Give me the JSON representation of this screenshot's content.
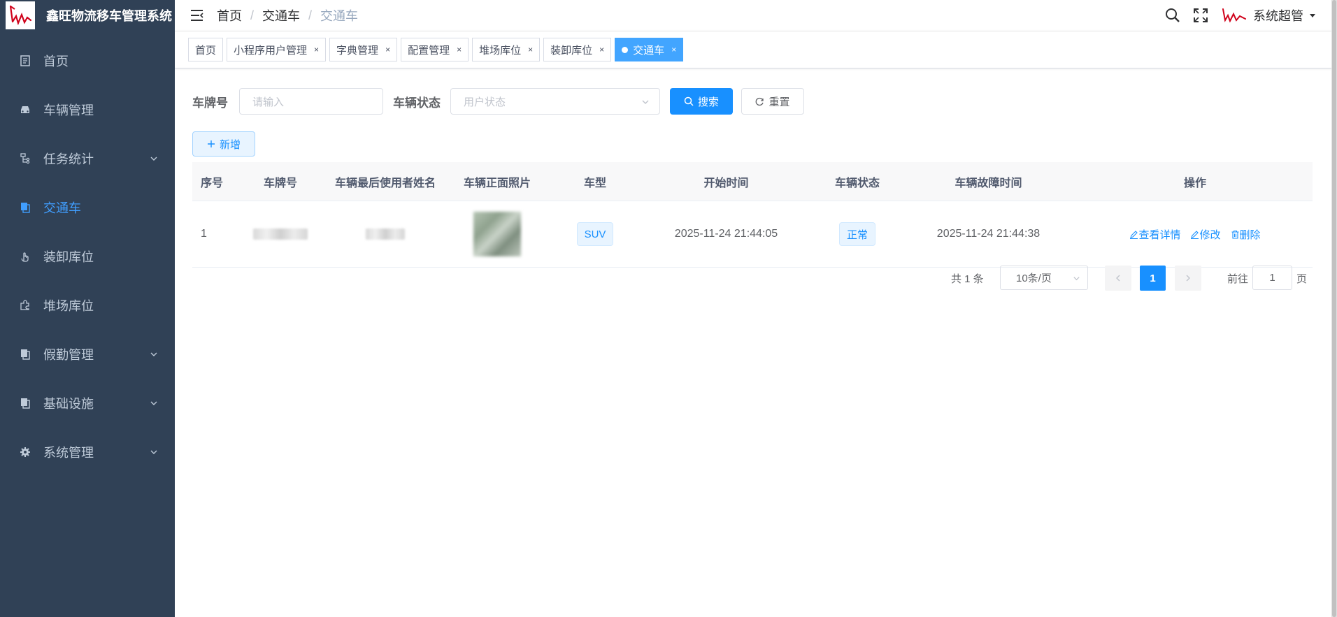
{
  "app": {
    "title": "鑫旺物流移车管理系统"
  },
  "sidebar": {
    "items": [
      {
        "label": "首页",
        "icon": "dashboard-icon",
        "active": false,
        "expandable": false
      },
      {
        "label": "车辆管理",
        "icon": "car-icon",
        "active": false,
        "expandable": false
      },
      {
        "label": "任务统计",
        "icon": "tree-icon",
        "active": false,
        "expandable": true
      },
      {
        "label": "交通车",
        "icon": "documents-icon",
        "active": true,
        "expandable": false
      },
      {
        "label": "装卸库位",
        "icon": "hand-icon",
        "active": false,
        "expandable": false
      },
      {
        "label": "堆场库位",
        "icon": "puzzle-icon",
        "active": false,
        "expandable": false
      },
      {
        "label": "假勤管理",
        "icon": "documents-icon",
        "active": false,
        "expandable": true
      },
      {
        "label": "基础设施",
        "icon": "documents-icon",
        "active": false,
        "expandable": true
      },
      {
        "label": "系统管理",
        "icon": "gear-icon",
        "active": false,
        "expandable": true
      }
    ]
  },
  "breadcrumb": {
    "items": [
      "首页",
      "交通车",
      "交通车"
    ]
  },
  "user": {
    "name": "系统超管"
  },
  "tabs": [
    {
      "label": "首页",
      "closable": false,
      "active": false
    },
    {
      "label": "小程序用户管理",
      "closable": true,
      "active": false
    },
    {
      "label": "字典管理",
      "closable": true,
      "active": false
    },
    {
      "label": "配置管理",
      "closable": true,
      "active": false
    },
    {
      "label": "堆场库位",
      "closable": true,
      "active": false
    },
    {
      "label": "装卸库位",
      "closable": true,
      "active": false
    },
    {
      "label": "交通车",
      "closable": true,
      "active": true
    }
  ],
  "filters": {
    "plate_label": "车牌号",
    "plate_placeholder": "请输入",
    "status_label": "车辆状态",
    "status_placeholder": "用户状态",
    "search_label": "搜索",
    "reset_label": "重置"
  },
  "toolbar": {
    "add_label": "新增"
  },
  "table": {
    "headers": [
      "序号",
      "车牌号",
      "车辆最后使用者姓名",
      "车辆正面照片",
      "车型",
      "开始时间",
      "车辆状态",
      "车辆故障时间",
      "操作"
    ],
    "rows": [
      {
        "index": "1",
        "vehicle_type": "SUV",
        "start_time": "2025-11-24 21:44:05",
        "status": "正常",
        "fault_time": "2025-11-24 21:44:38"
      }
    ],
    "actions": {
      "view": "查看详情",
      "edit": "修改",
      "delete": "删除"
    }
  },
  "pagination": {
    "total_text": "共 1 条",
    "page_size": "10条/页",
    "current_page": "1",
    "goto_label": "前往",
    "goto_value": "1",
    "page_suffix": "页"
  },
  "colors": {
    "sidebar_bg": "#304156",
    "primary": "#1890ff",
    "active_menu": "#409eff"
  }
}
